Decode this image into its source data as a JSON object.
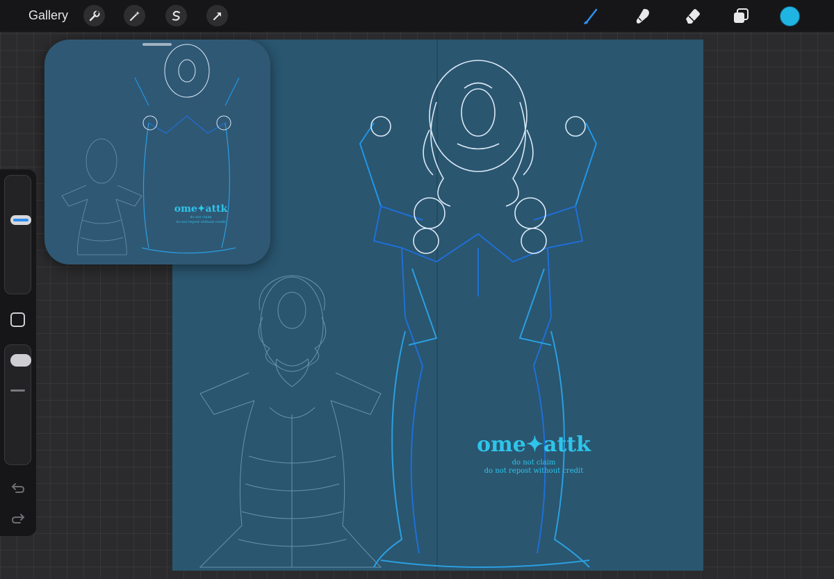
{
  "topbar": {
    "gallery_label": "Gallery",
    "left_tools": [
      "wrench-icon",
      "magic-wand-icon",
      "selection-s-icon",
      "transform-arrow-icon"
    ],
    "right_tools": [
      "brush-icon",
      "smudge-icon",
      "eraser-icon",
      "layers-icon"
    ],
    "active_tool": "brush-icon",
    "current_color": "#20b4e2",
    "active_accent": "#2c8ff0"
  },
  "canvas": {
    "background": "#2a5670",
    "watermark": {
      "title": "ome✦attk",
      "line1": "do not claim",
      "line2": "do not repost without credit"
    }
  },
  "reference": {
    "watermark": {
      "title": "ome✦attk",
      "line1": "do not claim",
      "line2": "do not repost without credit"
    }
  },
  "sidebar": {
    "controls": [
      "brush-size-slider",
      "modify-button",
      "brush-opacity-slider",
      "undo-icon",
      "redo-icon"
    ]
  }
}
